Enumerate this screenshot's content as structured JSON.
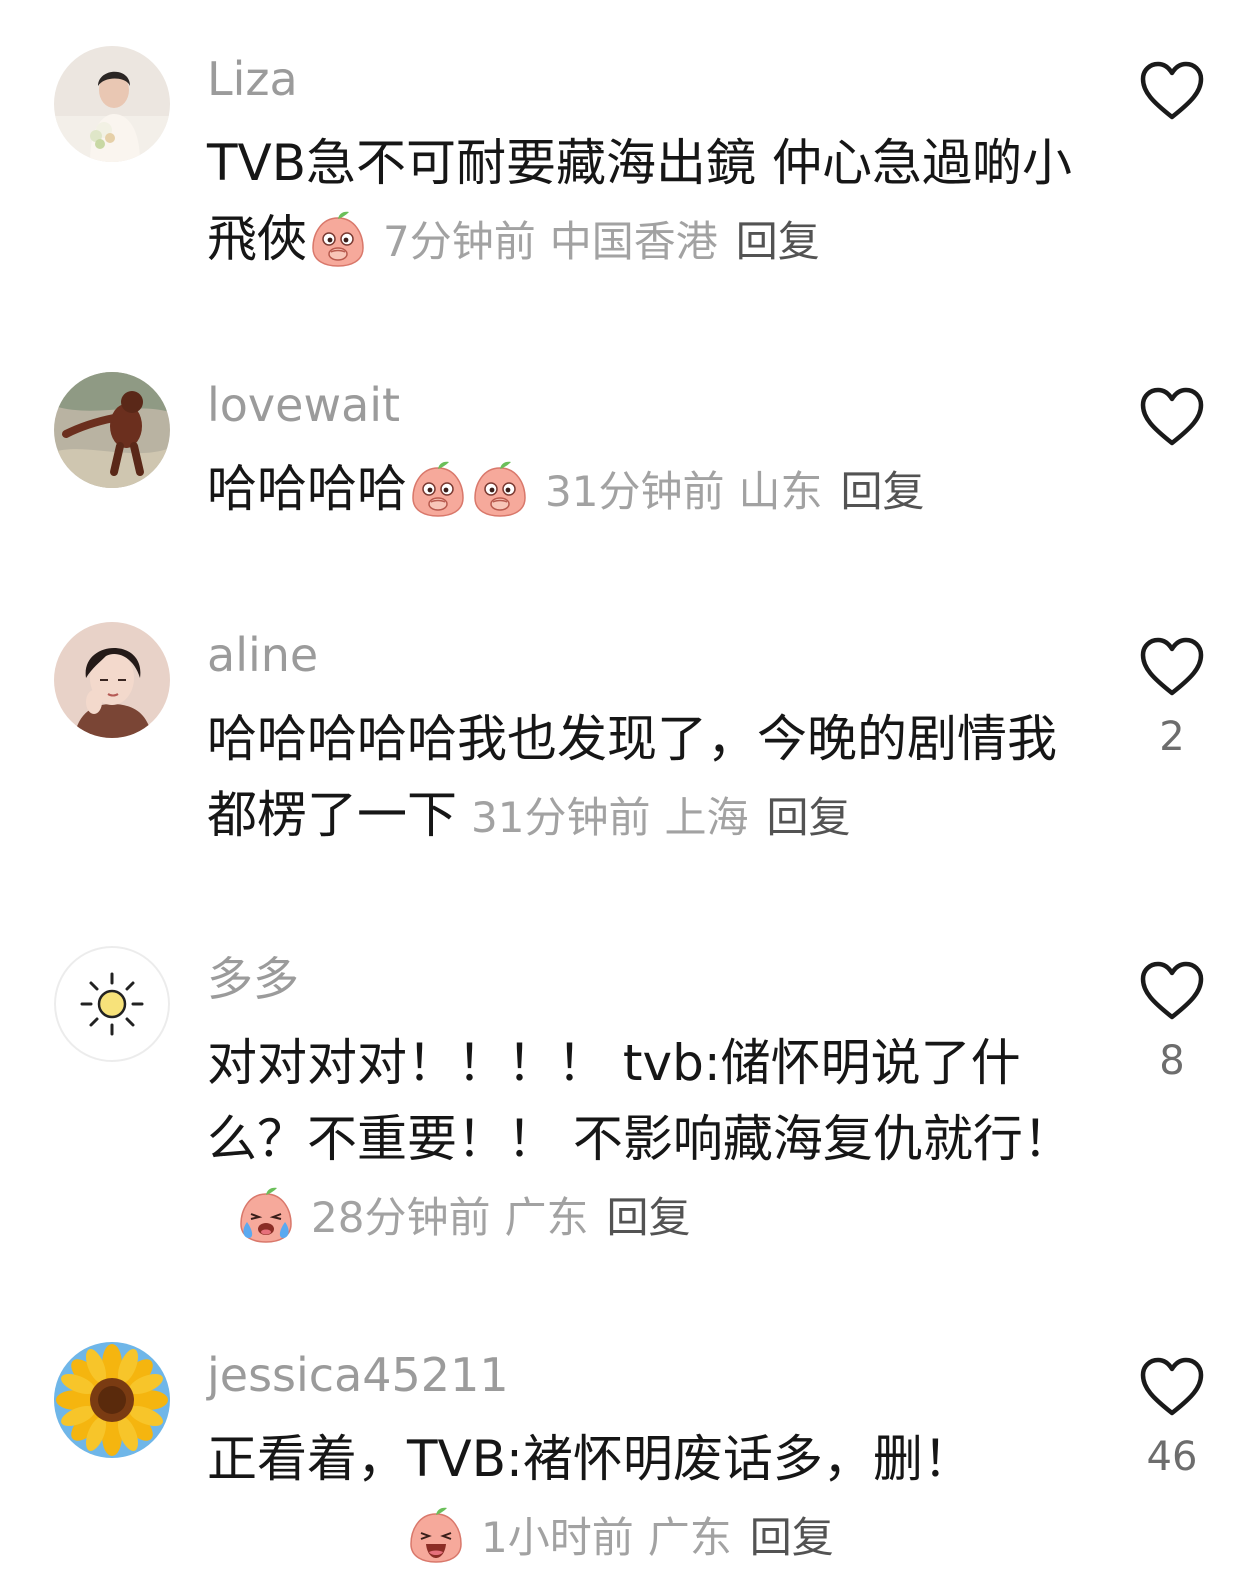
{
  "comments": [
    {
      "username": "Liza",
      "text": "TVB急不可耐要藏海出鏡 仲心急過啲小飛俠",
      "emojis": [
        "peach-shocked-emoji"
      ],
      "time": "7分钟前",
      "location": "中国香港",
      "reply_label": "回复",
      "like_count": null,
      "avatar": "person-with-flowers-avatar"
    },
    {
      "username": "lovewait",
      "text": "哈哈哈哈",
      "emojis": [
        "peach-shocked-emoji",
        "peach-shocked-emoji"
      ],
      "time": "31分钟前",
      "location": "山东",
      "reply_label": "回复",
      "like_count": null,
      "avatar": "orangutan-avatar"
    },
    {
      "username": "aline",
      "text": "哈哈哈哈哈我也发现了，今晚的剧情我都楞了一下",
      "emojis": [],
      "time": "31分钟前",
      "location": "上海",
      "reply_label": "回复",
      "like_count": "2",
      "avatar": "illustrated-man-avatar"
    },
    {
      "username": "多多",
      "text": "对对对对！！！！ tvb:储怀明说了什么？不重要！！ 不影响藏海复仇就行！",
      "emojis": [
        "peach-crying-emoji"
      ],
      "time": "28分钟前",
      "location": "广东",
      "reply_label": "回复",
      "like_count": "8",
      "avatar": "sun-avatar"
    },
    {
      "username": "jessica45211",
      "text": "正看着，TVB:褚怀明废话多，删！",
      "emojis": [
        "peach-laughing-emoji"
      ],
      "time": "1小时前",
      "location": "广东",
      "reply_label": "回复",
      "like_count": "46",
      "avatar": "sunflower-avatar"
    }
  ],
  "icons": {
    "like": "heart-outline-icon"
  },
  "colors": {
    "username": "#9b9b9b",
    "text": "#161616",
    "meta": "#a2a2a2",
    "reply": "#535353",
    "heart": "#1a1a1a"
  }
}
